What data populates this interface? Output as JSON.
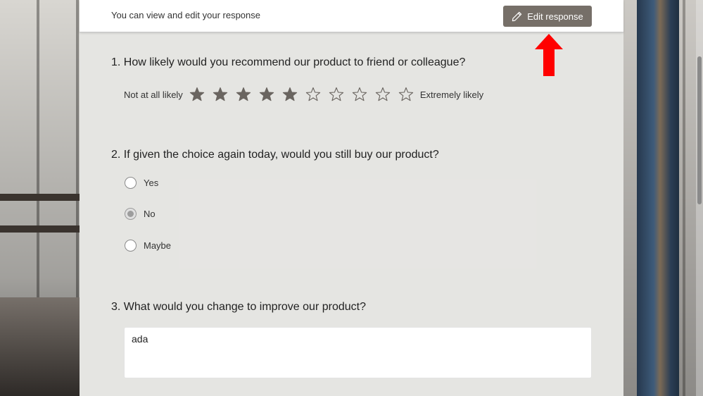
{
  "header": {
    "notice": "You can view and edit your response",
    "edit_button_label": "Edit response"
  },
  "questions": [
    {
      "text": "1. How likely would you recommend our product to friend or colleague?",
      "type": "rating",
      "min_label": "Not at all likely",
      "max_label": "Extremely likely",
      "rating": {
        "selected": 5,
        "max": 10
      }
    },
    {
      "text": "2. If given the choice again today, would you still buy our product?",
      "type": "choice",
      "options": [
        "Yes",
        "No",
        "Maybe"
      ],
      "selected": "No"
    },
    {
      "text": "3. What would you change to improve our product?",
      "type": "text",
      "answer": "ada"
    }
  ],
  "colors": {
    "edit_button": "#766f68",
    "annotation_arrow": "#ff0000",
    "star_filled": "#6a6560"
  }
}
